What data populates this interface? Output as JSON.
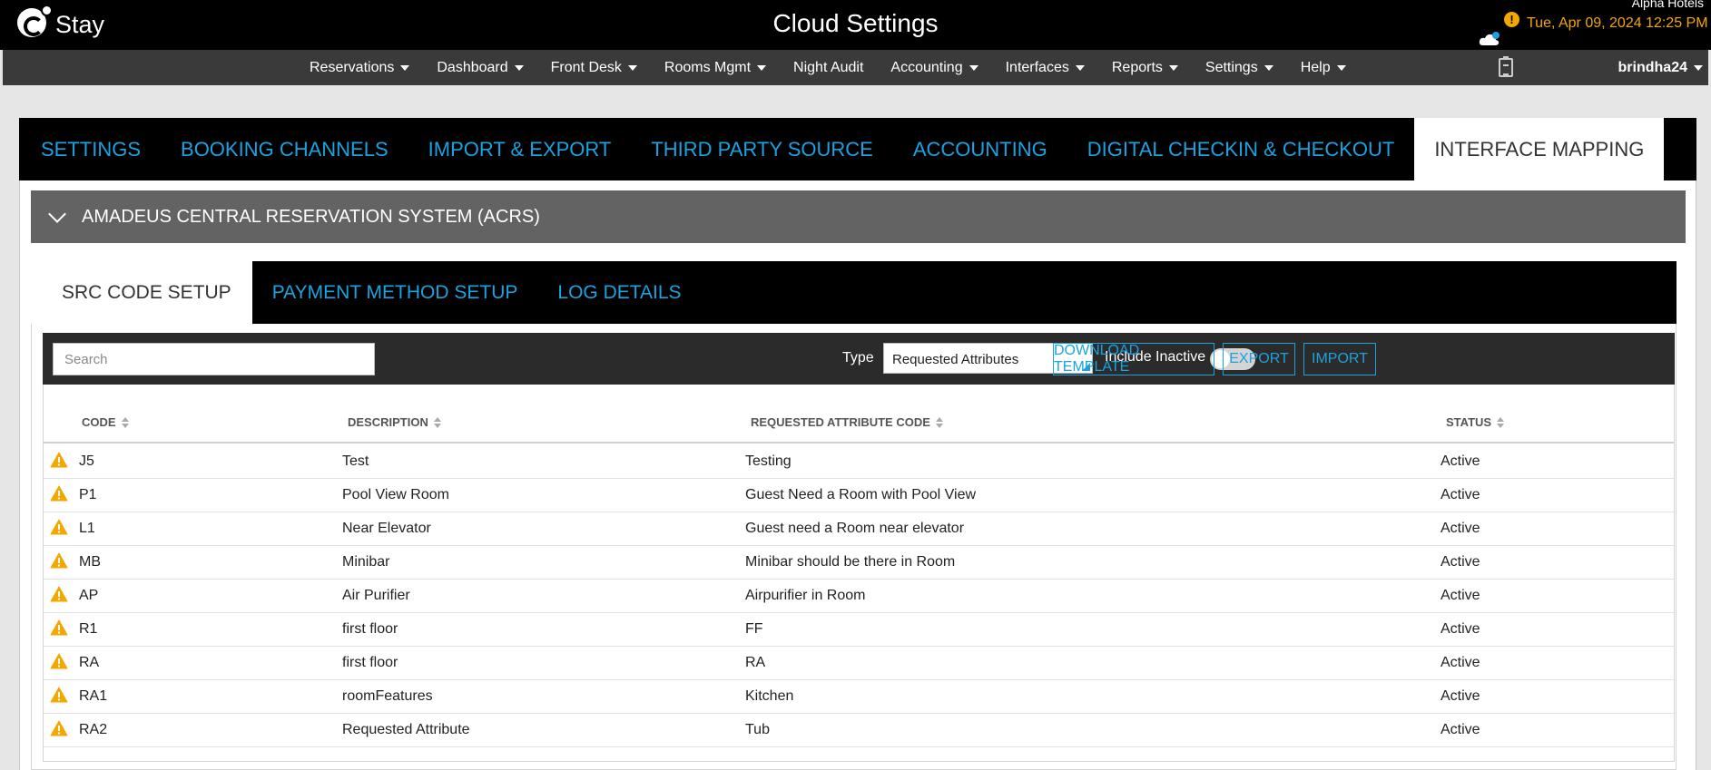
{
  "app": {
    "logo_text": "Stay",
    "title": "Cloud Settings",
    "hotel": "Alpha Hotels",
    "alert_badge": "!",
    "datetime": "Tue, Apr 09, 2024 12:25 PM"
  },
  "nav": {
    "items": [
      {
        "label": "Reservations",
        "dropdown": true
      },
      {
        "label": "Dashboard",
        "dropdown": true
      },
      {
        "label": "Front Desk",
        "dropdown": true
      },
      {
        "label": "Rooms Mgmt",
        "dropdown": true
      },
      {
        "label": "Night Audit",
        "dropdown": false
      },
      {
        "label": "Accounting",
        "dropdown": true
      },
      {
        "label": "Interfaces",
        "dropdown": true
      },
      {
        "label": "Reports",
        "dropdown": true
      },
      {
        "label": "Settings",
        "dropdown": true
      },
      {
        "label": "Help",
        "dropdown": true
      }
    ],
    "user": "brindha24"
  },
  "main_tabs": [
    "SETTINGS",
    "BOOKING CHANNELS",
    "IMPORT & EXPORT",
    "THIRD PARTY SOURCE",
    "ACCOUNTING",
    "DIGITAL CHECKIN & CHECKOUT",
    "INTERFACE MAPPING"
  ],
  "section": {
    "title": "AMADEUS CENTRAL RESERVATION SYSTEM (ACRS)"
  },
  "sub_tabs": [
    "SRC CODE SETUP",
    "PAYMENT METHOD SETUP",
    "LOG DETAILS"
  ],
  "toolbar": {
    "search_placeholder": "Search",
    "type_label": "Type",
    "type_value": "Requested Attributes",
    "include_inactive_label": "Include Inactive",
    "include_inactive": false,
    "download_label": "DOWNLOAD TEMPLATE",
    "export_label": "EXPORT",
    "import_label": "IMPORT"
  },
  "table": {
    "columns": [
      "CODE",
      "DESCRIPTION",
      "REQUESTED ATTRIBUTE CODE",
      "STATUS"
    ],
    "rows": [
      [
        "J5",
        "Test",
        "Testing",
        "Active"
      ],
      [
        "P1",
        "Pool View Room",
        "Guest Need a Room with Pool View",
        "Active"
      ],
      [
        "L1",
        "Near Elevator",
        "Guest need a Room near elevator",
        "Active"
      ],
      [
        "MB",
        "Minibar",
        "Minibar should be there in Room",
        "Active"
      ],
      [
        "AP",
        "Air Purifier",
        "Airpurifier in Room",
        "Active"
      ],
      [
        "R1",
        "first floor",
        "FF",
        "Active"
      ],
      [
        "RA",
        "first floor",
        "RA",
        "Active"
      ],
      [
        "RA1",
        "roomFeatures",
        "Kitchen",
        "Active"
      ],
      [
        "RA2",
        "Requested Attribute",
        "Tub",
        "Active"
      ]
    ]
  },
  "colors": {
    "accent": "#1aa3e0",
    "warning": "#f2a800",
    "topbar": "#000000",
    "navbar": "#3a3a3a",
    "section": "#636363"
  }
}
